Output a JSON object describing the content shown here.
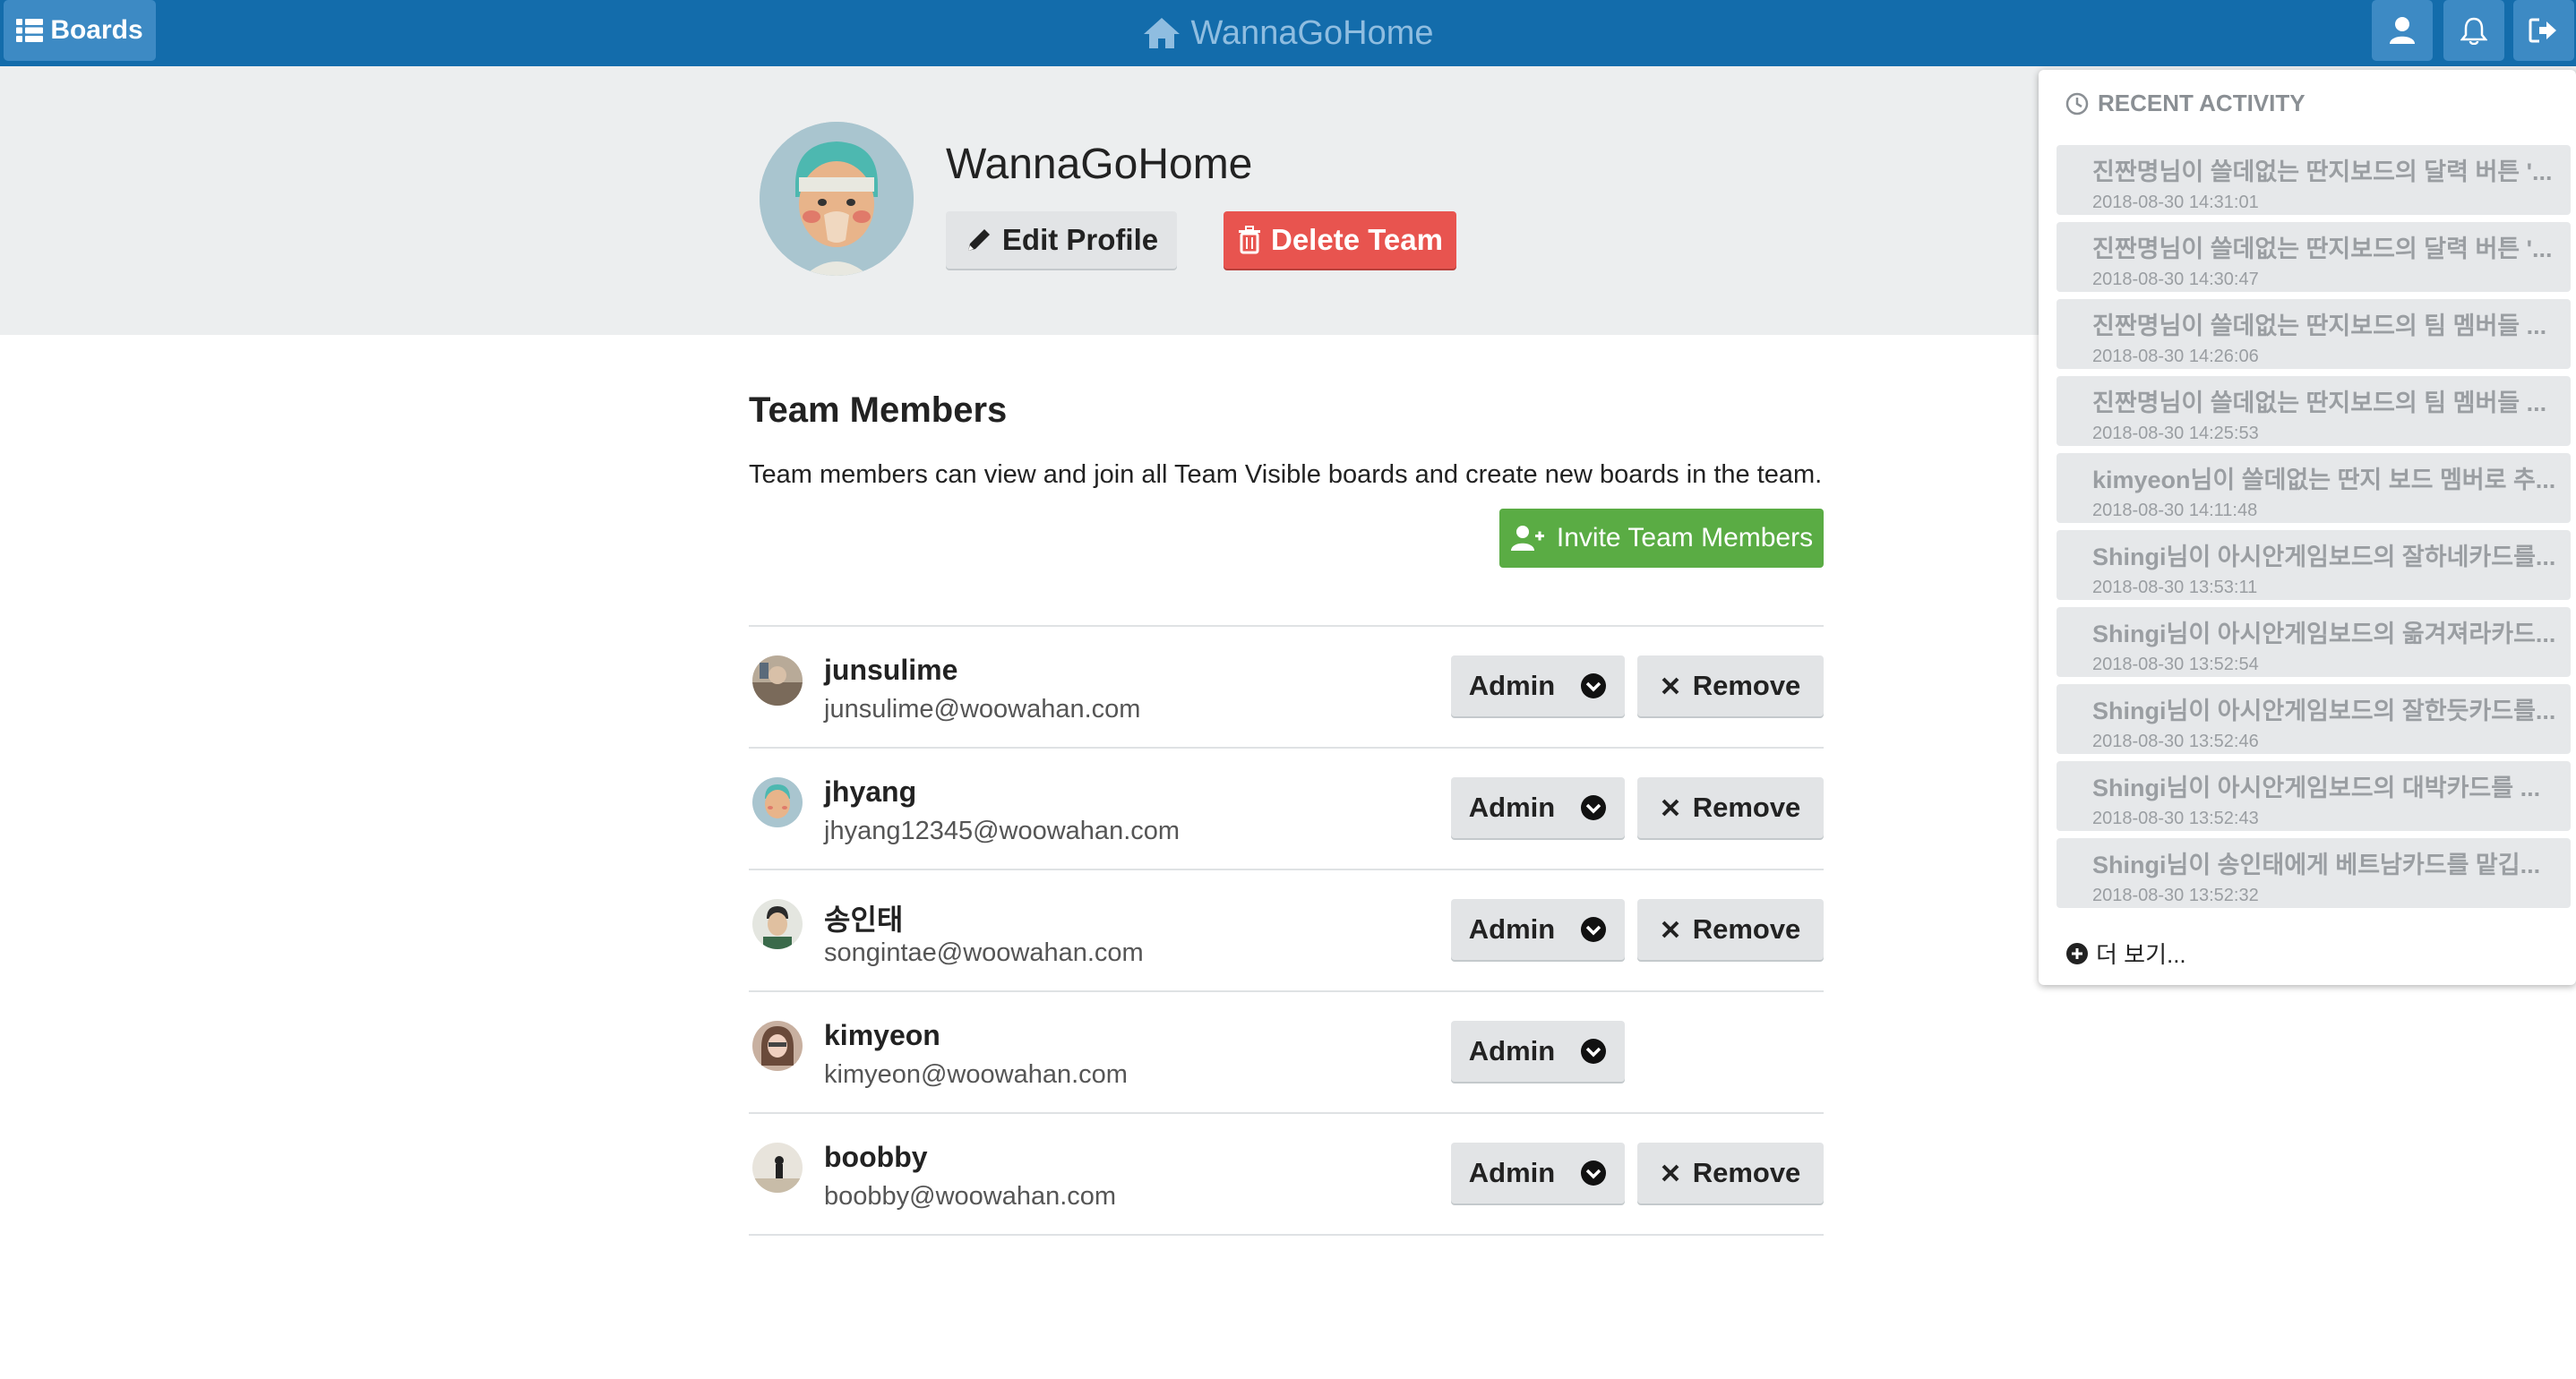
{
  "topbar": {
    "boards_label": "Boards",
    "brand": "WannaGoHome",
    "icons": [
      "user-icon",
      "bell-icon",
      "logout-icon"
    ]
  },
  "team": {
    "name": "WannaGoHome",
    "edit_label": "Edit Profile",
    "delete_label": "Delete Team"
  },
  "members_section": {
    "title": "Team Members",
    "description": "Team members can view and join all Team Visible boards and create new boards in the team.",
    "invite_label": "Invite Team Members",
    "members": [
      {
        "name": "junsulime",
        "email": "junsulime@woowahan.com",
        "role": "Admin",
        "remove": "Remove"
      },
      {
        "name": "jhyang",
        "email": "jhyang12345@woowahan.com",
        "role": "Admin",
        "remove": "Remove"
      },
      {
        "name": "송인태",
        "email": "songintae@woowahan.com",
        "role": "Admin",
        "remove": "Remove"
      },
      {
        "name": "kimyeon",
        "email": "kimyeon@woowahan.com",
        "role": "Admin",
        "remove": null
      },
      {
        "name": "boobby",
        "email": "boobby@woowahan.com",
        "role": "Admin",
        "remove": "Remove"
      }
    ]
  },
  "activity": {
    "title": "RECENT ACTIVITY",
    "more_label": "더 보기...",
    "items": [
      {
        "text": "진짠명님이 쓸데없는 딴지보드의 달력 버튼 '...",
        "time": "2018-08-30 14:31:01"
      },
      {
        "text": "진짠명님이 쓸데없는 딴지보드의 달력 버튼 '...",
        "time": "2018-08-30 14:30:47"
      },
      {
        "text": "진짠명님이 쓸데없는 딴지보드의 팀 멤버들 ...",
        "time": "2018-08-30 14:26:06"
      },
      {
        "text": "진짠명님이 쓸데없는 딴지보드의 팀 멤버들 ...",
        "time": "2018-08-30 14:25:53"
      },
      {
        "text": "kimyeon님이 쓸데없는 딴지 보드 멤버로 추...",
        "time": "2018-08-30 14:11:48"
      },
      {
        "text": "Shingi님이 아시안게임보드의 잘하네카드를...",
        "time": "2018-08-30 13:53:11"
      },
      {
        "text": "Shingi님이 아시안게임보드의 옮겨져라카드...",
        "time": "2018-08-30 13:52:54"
      },
      {
        "text": "Shingi님이 아시안게임보드의 잘한듯카드를...",
        "time": "2018-08-30 13:52:46"
      },
      {
        "text": "Shingi님이 아시안게임보드의 대박카드를 ...",
        "time": "2018-08-30 13:52:43"
      },
      {
        "text": "Shingi님이 송인태에게 베트남카드를 맡깁...",
        "time": "2018-08-30 13:52:32"
      }
    ]
  }
}
